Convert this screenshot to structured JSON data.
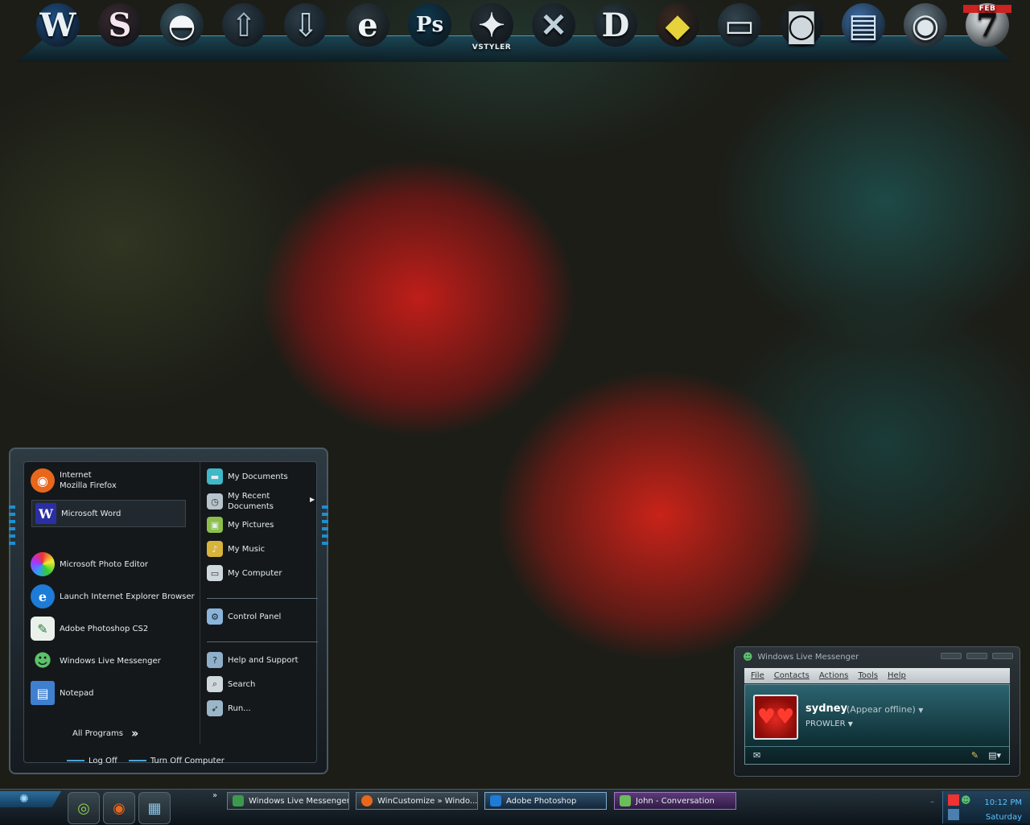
{
  "dock": {
    "icons": [
      {
        "name": "word-icon",
        "glyph": "W",
        "color": "#e9f0f4",
        "bg": "#1e4f88"
      },
      {
        "name": "skype-icon",
        "glyph": "S",
        "color": "#f3e6ee",
        "bg": "#3a2a30"
      },
      {
        "name": "globe-icon",
        "glyph": "◓",
        "color": "#f2f6f8",
        "bg": "#3b5966"
      },
      {
        "name": "up-arrow-icon",
        "glyph": "⇧",
        "color": "#9fb5c4",
        "bg": "#2d3e4a"
      },
      {
        "name": "down-arrow-icon",
        "glyph": "⇩",
        "color": "#bcd3dd",
        "bg": "#2d3e4a"
      },
      {
        "name": "ie-icon",
        "glyph": "e",
        "color": "#f1f5f7",
        "bg": "#2e3a40"
      },
      {
        "name": "photoshop-icon",
        "glyph": "Ps",
        "color": "#e7f0f6",
        "bg": "#0f3a52"
      },
      {
        "name": "vstyler-icon",
        "glyph": "✦",
        "color": "#e6ecef",
        "bg": "#263036",
        "label": "VSTYLER"
      },
      {
        "name": "tools-icon",
        "glyph": "✕",
        "color": "#bfd1da",
        "bg": "#243038"
      },
      {
        "name": "d-icon",
        "glyph": "D",
        "color": "#e6edf0",
        "bg": "#2b3840"
      },
      {
        "name": "games-icon",
        "glyph": "◆",
        "color": "#e6d23a",
        "bg": "#3b2a20"
      },
      {
        "name": "laptop-icon",
        "glyph": "▭",
        "color": "#dfe8ec",
        "bg": "#33444e"
      },
      {
        "name": "camera-icon",
        "glyph": "◙",
        "color": "#cfd8dc",
        "bg": "#25292c"
      },
      {
        "name": "folder-icon",
        "glyph": "▤",
        "color": "#cfe6ff",
        "bg": "#3f6fa8"
      },
      {
        "name": "webcam-icon",
        "glyph": "◉",
        "color": "#dfe7ec",
        "bg": "#6b7c86"
      },
      {
        "name": "calendar-icon",
        "glyph": "7",
        "color": "#111",
        "bg": "#eef2f4",
        "label": "FEB"
      }
    ]
  },
  "start_menu": {
    "pinned": [
      {
        "title": "Internet",
        "subtitle": "Mozilla Firefox",
        "icon": "firefox-icon",
        "color": "#e8671c"
      },
      {
        "title": "Microsoft Word",
        "icon": "word-icon",
        "color": "#2b2fa4"
      }
    ],
    "recent": [
      {
        "label": "Microsoft Photo Editor",
        "icon": "photo-editor-icon",
        "color": "#7a3fb8"
      },
      {
        "label": "Launch Internet Explorer Browser",
        "icon": "ie-icon",
        "color": "#1e7bd6"
      },
      {
        "label": "Adobe Photoshop CS2",
        "icon": "photoshop-icon",
        "color": "#2c7a3b"
      },
      {
        "label": "Windows Live Messenger",
        "icon": "messenger-icon",
        "color": "#3c9a4e"
      },
      {
        "label": "Notepad",
        "icon": "notepad-icon",
        "color": "#3f7fcf"
      }
    ],
    "all_programs": "All Programs",
    "places": [
      {
        "label": "My Documents",
        "icon": "my-documents-icon",
        "color": "#3fb8c7"
      },
      {
        "label": "My Recent Documents",
        "line1": "My Recent",
        "line2": "Documents",
        "icon": "recent-documents-icon",
        "color": "#b8c4cc"
      },
      {
        "label": "My Pictures",
        "icon": "my-pictures-icon",
        "color": "#8cbf4a"
      },
      {
        "label": "My Music",
        "icon": "my-music-icon",
        "color": "#d7b43a"
      },
      {
        "label": "My Computer",
        "icon": "my-computer-icon",
        "color": "#cfd8dc"
      },
      {
        "label": "Control Panel",
        "icon": "control-panel-icon",
        "color": "#8ab4d9"
      },
      {
        "label": "Help and Support",
        "icon": "help-icon",
        "color": "#8fb0c8"
      },
      {
        "label": "Search",
        "icon": "search-icon",
        "color": "#cfd8dc"
      },
      {
        "label": "Run...",
        "icon": "run-icon",
        "color": "#9bb6c6"
      }
    ],
    "log_off": "Log Off",
    "turn_off": "Turn Off Computer"
  },
  "messenger": {
    "title": "Windows Live Messenger",
    "menu": [
      "File",
      "Contacts",
      "Actions",
      "Tools",
      "Help"
    ],
    "user_name": "sydney",
    "status": "(Appear offline)",
    "personal_message": "PROWLER"
  },
  "taskbar": {
    "tasks": [
      {
        "label": "Windows Live Messenger",
        "color": "#3c9a4e"
      },
      {
        "label": "WinCustomize » Windo...",
        "color": "#e8671c"
      },
      {
        "label": "Adobe Photoshop",
        "color": "#1e7bd6"
      },
      {
        "label": "John - Conversation",
        "color": "#6bbd5a"
      }
    ],
    "clock_time": "10:12 PM",
    "clock_day": "Saturday"
  }
}
